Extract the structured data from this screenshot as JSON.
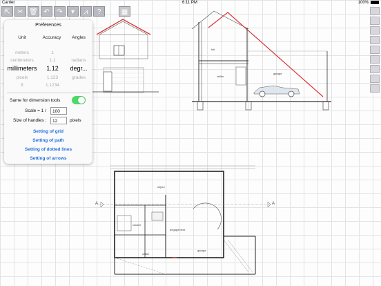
{
  "status": {
    "carrier": "Carrier",
    "time": "6:11 PM",
    "battery": "100%"
  },
  "toolbar": {
    "icons": [
      "export-icon",
      "cut-icon",
      "delete-icon",
      "undo-icon",
      "redo-icon",
      "dropdown-icon",
      "graph-icon",
      "help-icon",
      "calculator-icon"
    ]
  },
  "prefs": {
    "title": "Preferences",
    "col_unit": "Unit",
    "col_accuracy": "Accuracy",
    "col_angles": "Angles",
    "units": [
      "meters",
      "centimeters",
      "millimeters",
      "pixels",
      "ft"
    ],
    "accuracies": [
      "1",
      "1.1",
      "1.12",
      "1.123",
      "1.1234"
    ],
    "angles": [
      "radians",
      "degr...",
      "grades"
    ],
    "selected_unit": "millimeters",
    "selected_accuracy": "1.12",
    "selected_angle": "degr...",
    "same_for_dimension_tools_label": "Same for dimension tools",
    "same_for_dimension_tools_on": true,
    "scale_label": "Scale = 1 /",
    "scale_value": "100",
    "handles_label": "Size of handles :",
    "handles_value": "12",
    "handles_unit": "pixels",
    "links": [
      "Setting of grid",
      "Setting of path",
      "Setting of dotted lines",
      "Setting of arrows"
    ]
  },
  "plan_labels": {
    "section": [
      "toit",
      "cellier",
      "garage"
    ],
    "plan": [
      "séjour",
      "cuisine",
      "cellier",
      "garage",
      "dégagement"
    ],
    "markers": [
      "A",
      "A"
    ]
  }
}
